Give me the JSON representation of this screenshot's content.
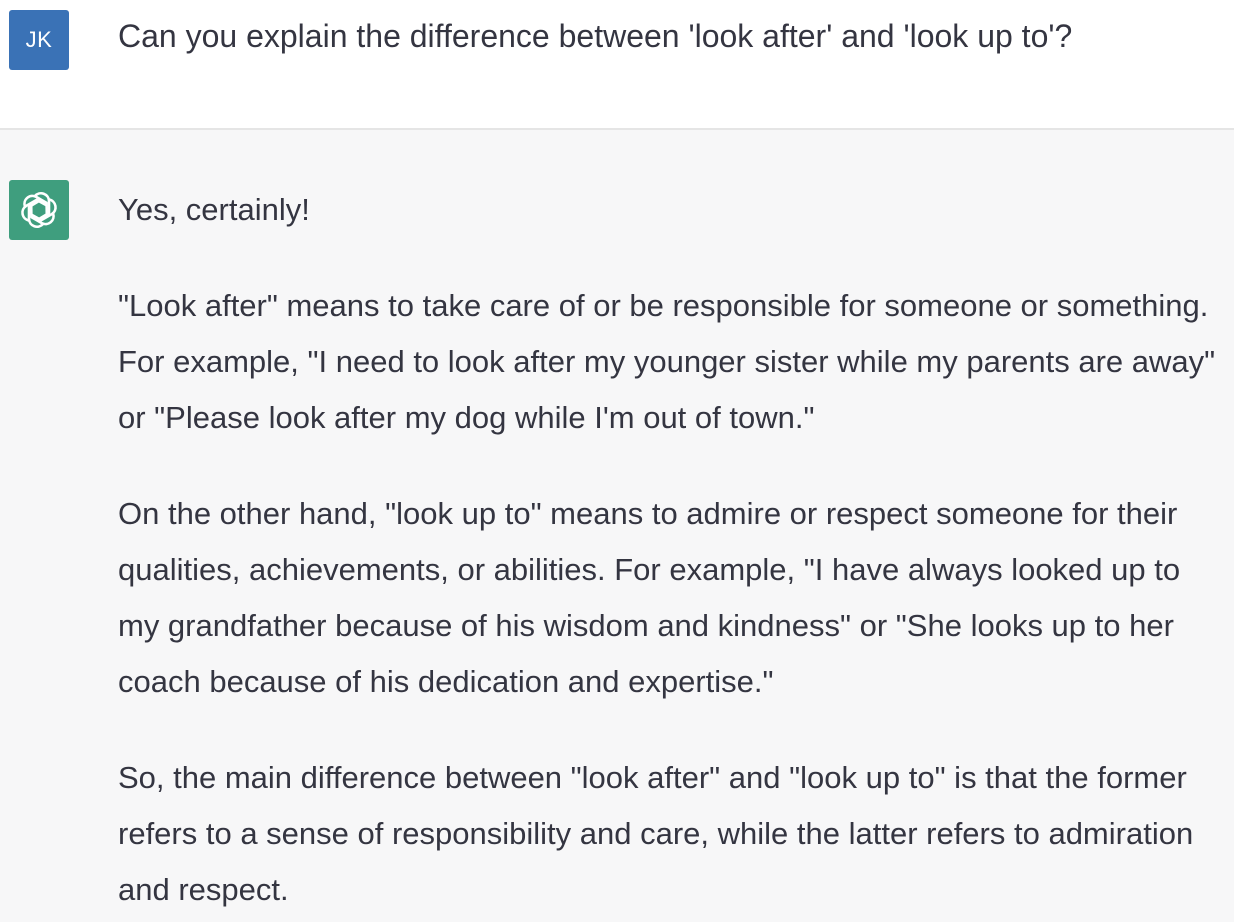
{
  "user": {
    "avatar_initials": "JK",
    "avatar_color": "#3a72b6",
    "message": "Can you explain the difference between 'look after' and 'look up to'?"
  },
  "assistant": {
    "avatar_icon": "openai-logo-icon",
    "avatar_color": "#3f9e7e",
    "paragraphs": [
      "Yes, certainly!",
      "\"Look after\" means to take care of or be responsible for someone or something. For example, \"I need to look after my younger sister while my parents are away\" or \"Please look after my dog while I'm out of town.\"",
      "On the other hand, \"look up to\" means to admire or respect someone for their qualities, achievements, or abilities. For example, \"I have always looked up to my grandfather because of his wisdom and kindness\" or \"She looks up to her coach because of his dedication and expertise.\"",
      "So, the main difference between \"look after\" and \"look up to\" is that the former refers to a sense of responsibility and care, while the latter refers to admiration and respect."
    ]
  }
}
